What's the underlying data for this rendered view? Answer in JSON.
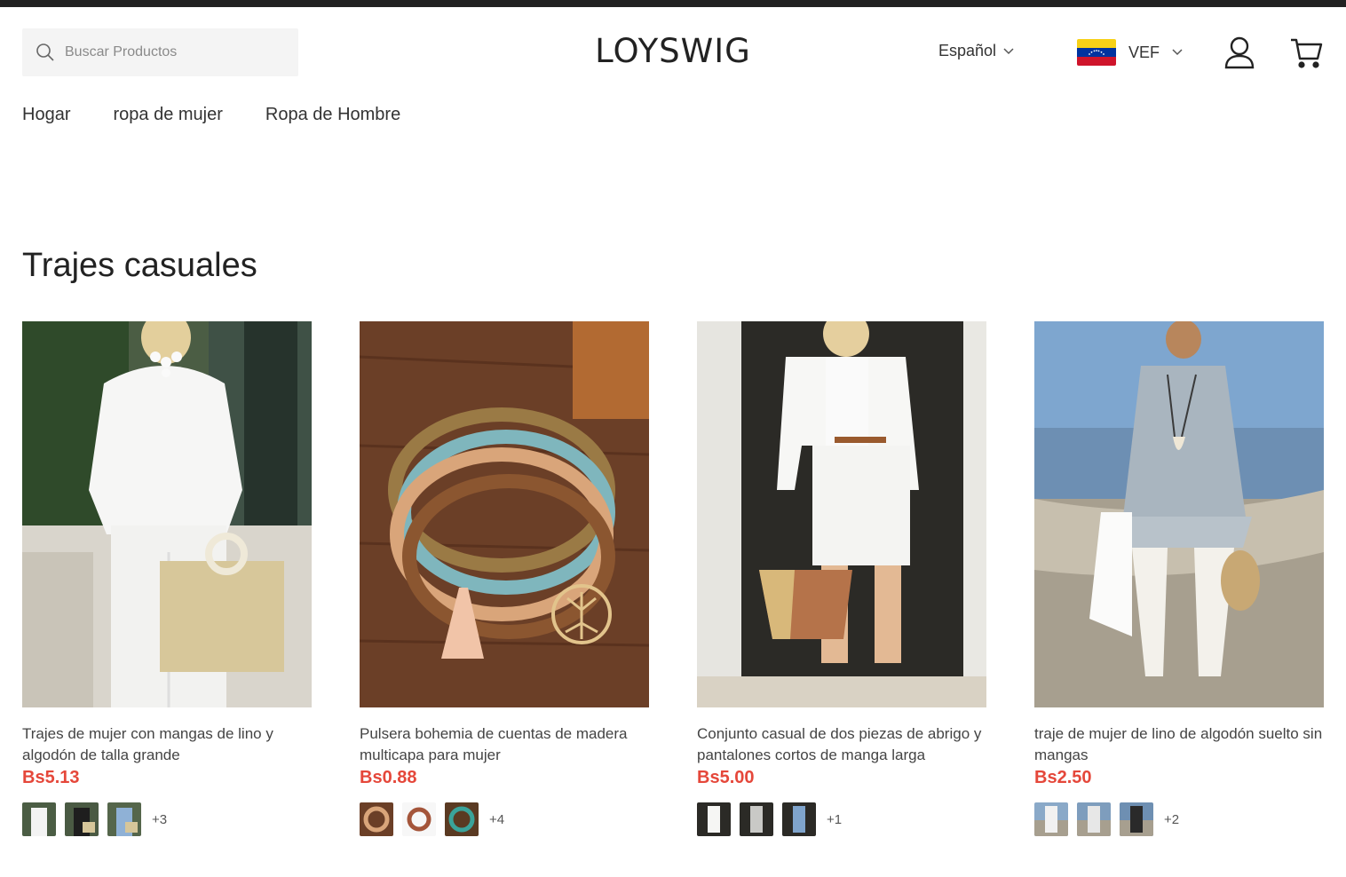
{
  "search": {
    "placeholder": "Buscar Productos"
  },
  "header": {
    "logo": "LOYSWIG",
    "language": "Español",
    "currency": "VEF",
    "flag_colors": [
      "#f7d117",
      "#0033a0",
      "#cf142b"
    ]
  },
  "nav": {
    "items": [
      "Hogar",
      "ropa de mujer",
      "Ropa de Hombre"
    ]
  },
  "section": {
    "title": "Trajes casuales"
  },
  "colors": {
    "price": "#e5473a",
    "search_bg": "#f4f4f4"
  },
  "products": [
    {
      "title": "Trajes de mujer con mangas de lino y algodón de talla grande",
      "price": "Bs5.13",
      "more_variants": "+3"
    },
    {
      "title": "Pulsera bohemia de cuentas de madera multicapa para mujer",
      "price": "Bs0.88",
      "more_variants": "+4"
    },
    {
      "title": "Conjunto casual de dos piezas de abrigo y pantalones cortos de manga larga",
      "price": "Bs5.00",
      "more_variants": "+1"
    },
    {
      "title": "traje de mujer de lino de algodón suelto sin mangas",
      "price": "Bs2.50",
      "more_variants": "+2"
    }
  ]
}
